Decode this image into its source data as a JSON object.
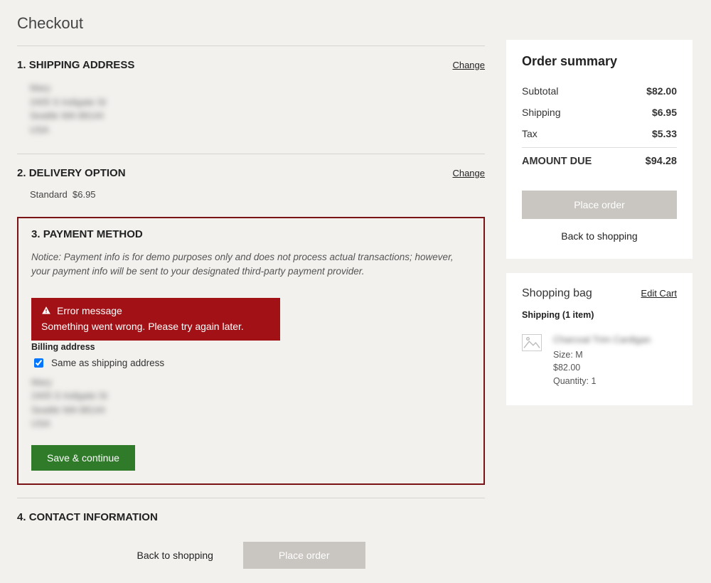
{
  "page_title": "Checkout",
  "sections": {
    "shipping": {
      "num": "1.",
      "title": "SHIPPING ADDRESS",
      "change": "Change",
      "address_redacted": [
        "Mary",
        "2405 S Indigate St",
        "Seattle WA 98144",
        "USA"
      ]
    },
    "delivery": {
      "num": "2.",
      "title": "DELIVERY OPTION",
      "change": "Change",
      "option_label": "Standard",
      "option_price": "$6.95"
    },
    "payment": {
      "num": "3.",
      "title": "PAYMENT METHOD",
      "notice": "Notice: Payment info is for demo purposes only and does not process actual transactions; however, your payment info will be sent to your designated third-party payment provider.",
      "error_title": "Error message",
      "error_body": "Something went wrong. Please try again later.",
      "billing_label": "Billing address",
      "same_as_shipping": "Same as shipping address",
      "same_as_shipping_checked": true,
      "billing_redacted": [
        "Mary",
        "2405 S Indigate St",
        "Seattle WA 98144",
        "USA"
      ],
      "save_btn": "Save & continue"
    },
    "contact": {
      "num": "4.",
      "title": "CONTACT INFORMATION"
    }
  },
  "bottom": {
    "back": "Back to shopping",
    "place_order": "Place order"
  },
  "summary": {
    "title": "Order summary",
    "subtotal_label": "Subtotal",
    "subtotal": "$82.00",
    "shipping_label": "Shipping",
    "shipping": "$6.95",
    "tax_label": "Tax",
    "tax": "$5.33",
    "due_label": "AMOUNT DUE",
    "due": "$94.28",
    "place_order": "Place order",
    "back": "Back to shopping"
  },
  "bag": {
    "title": "Shopping bag",
    "edit": "Edit Cart",
    "shipping_count": "Shipping (1 item)",
    "item": {
      "name_redacted": "Charcoal Trim Cardigan",
      "size": "Size: M",
      "price": "$82.00",
      "qty": "Quantity: 1"
    }
  }
}
